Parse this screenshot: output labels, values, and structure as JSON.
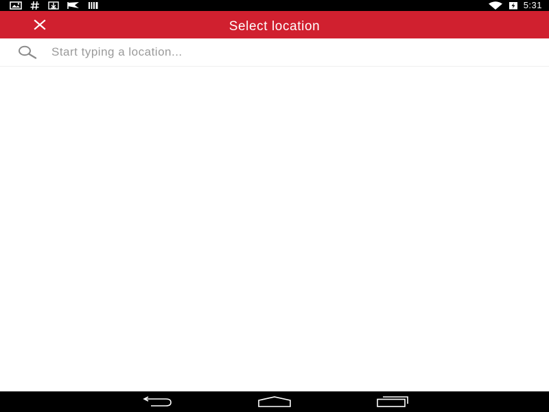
{
  "status_bar": {
    "left_icons": [
      "gallery-notification-icon",
      "hash-notification-icon",
      "download-notification-icon",
      "flag-notification-icon",
      "barcode-notification-icon"
    ],
    "right_icons": [
      "wifi-icon",
      "battery-charging-icon"
    ],
    "time": "5:31"
  },
  "app_bar": {
    "title": "Select location",
    "close_icon": "close-icon",
    "color": "#d0202f"
  },
  "search": {
    "icon": "search-icon",
    "placeholder": "Start typing a location...",
    "value": ""
  },
  "nav_bar": {
    "buttons": [
      "back-icon",
      "home-icon",
      "recents-icon"
    ]
  }
}
